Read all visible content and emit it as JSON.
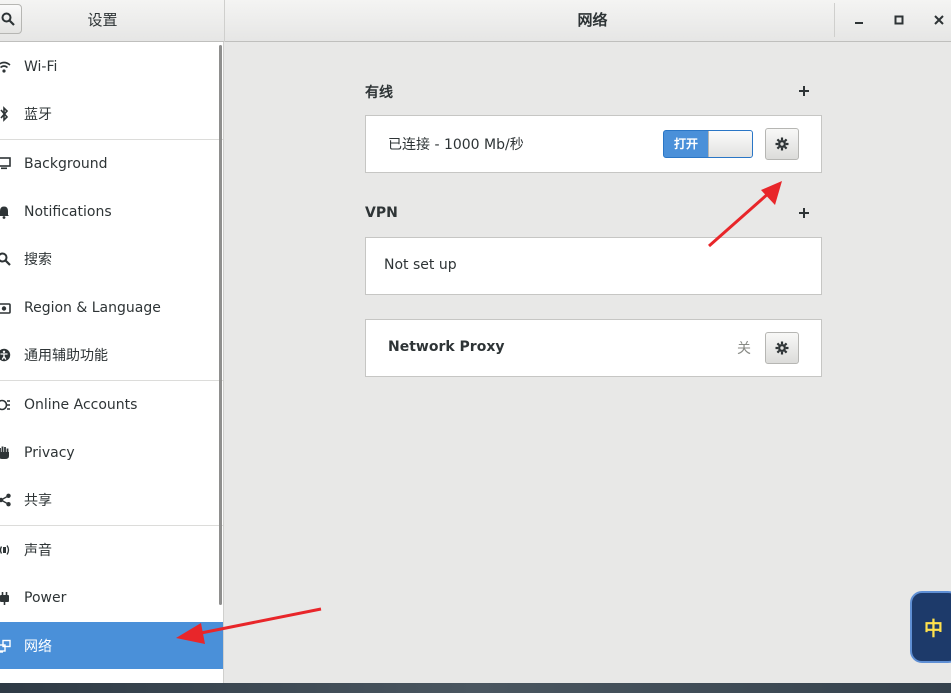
{
  "header": {
    "left_title": "设置",
    "title": "网络"
  },
  "sidebar": {
    "items": [
      {
        "label": "Wi-Fi",
        "icon": "wifi-icon"
      },
      {
        "label": "蓝牙",
        "icon": "bluetooth-icon"
      },
      {
        "label": "Background",
        "icon": "display-icon"
      },
      {
        "label": "Notifications",
        "icon": "bell-icon"
      },
      {
        "label": "搜索",
        "icon": "search-icon"
      },
      {
        "label": "Region & Language",
        "icon": "camera-icon"
      },
      {
        "label": "通用辅助功能",
        "icon": "accessibility-icon"
      },
      {
        "label": "Online Accounts",
        "icon": "online-accounts-icon"
      },
      {
        "label": "Privacy",
        "icon": "hand-icon"
      },
      {
        "label": "共享",
        "icon": "share-icon"
      },
      {
        "label": "声音",
        "icon": "speaker-icon"
      },
      {
        "label": "Power",
        "icon": "power-icon"
      },
      {
        "label": "网络",
        "icon": "network-icon",
        "selected": true
      }
    ]
  },
  "main": {
    "wired": {
      "title": "有线",
      "status": "已连接 - 1000 Mb/秒",
      "switch_label": "打开",
      "switch_on": true
    },
    "vpn": {
      "title": "VPN",
      "empty_text": "Not set up"
    },
    "proxy": {
      "title": "Network Proxy",
      "status": "关"
    }
  },
  "ime": {
    "label": "中"
  },
  "colors": {
    "accent": "#4a90d9",
    "annotation_arrow": "#e8262a"
  }
}
